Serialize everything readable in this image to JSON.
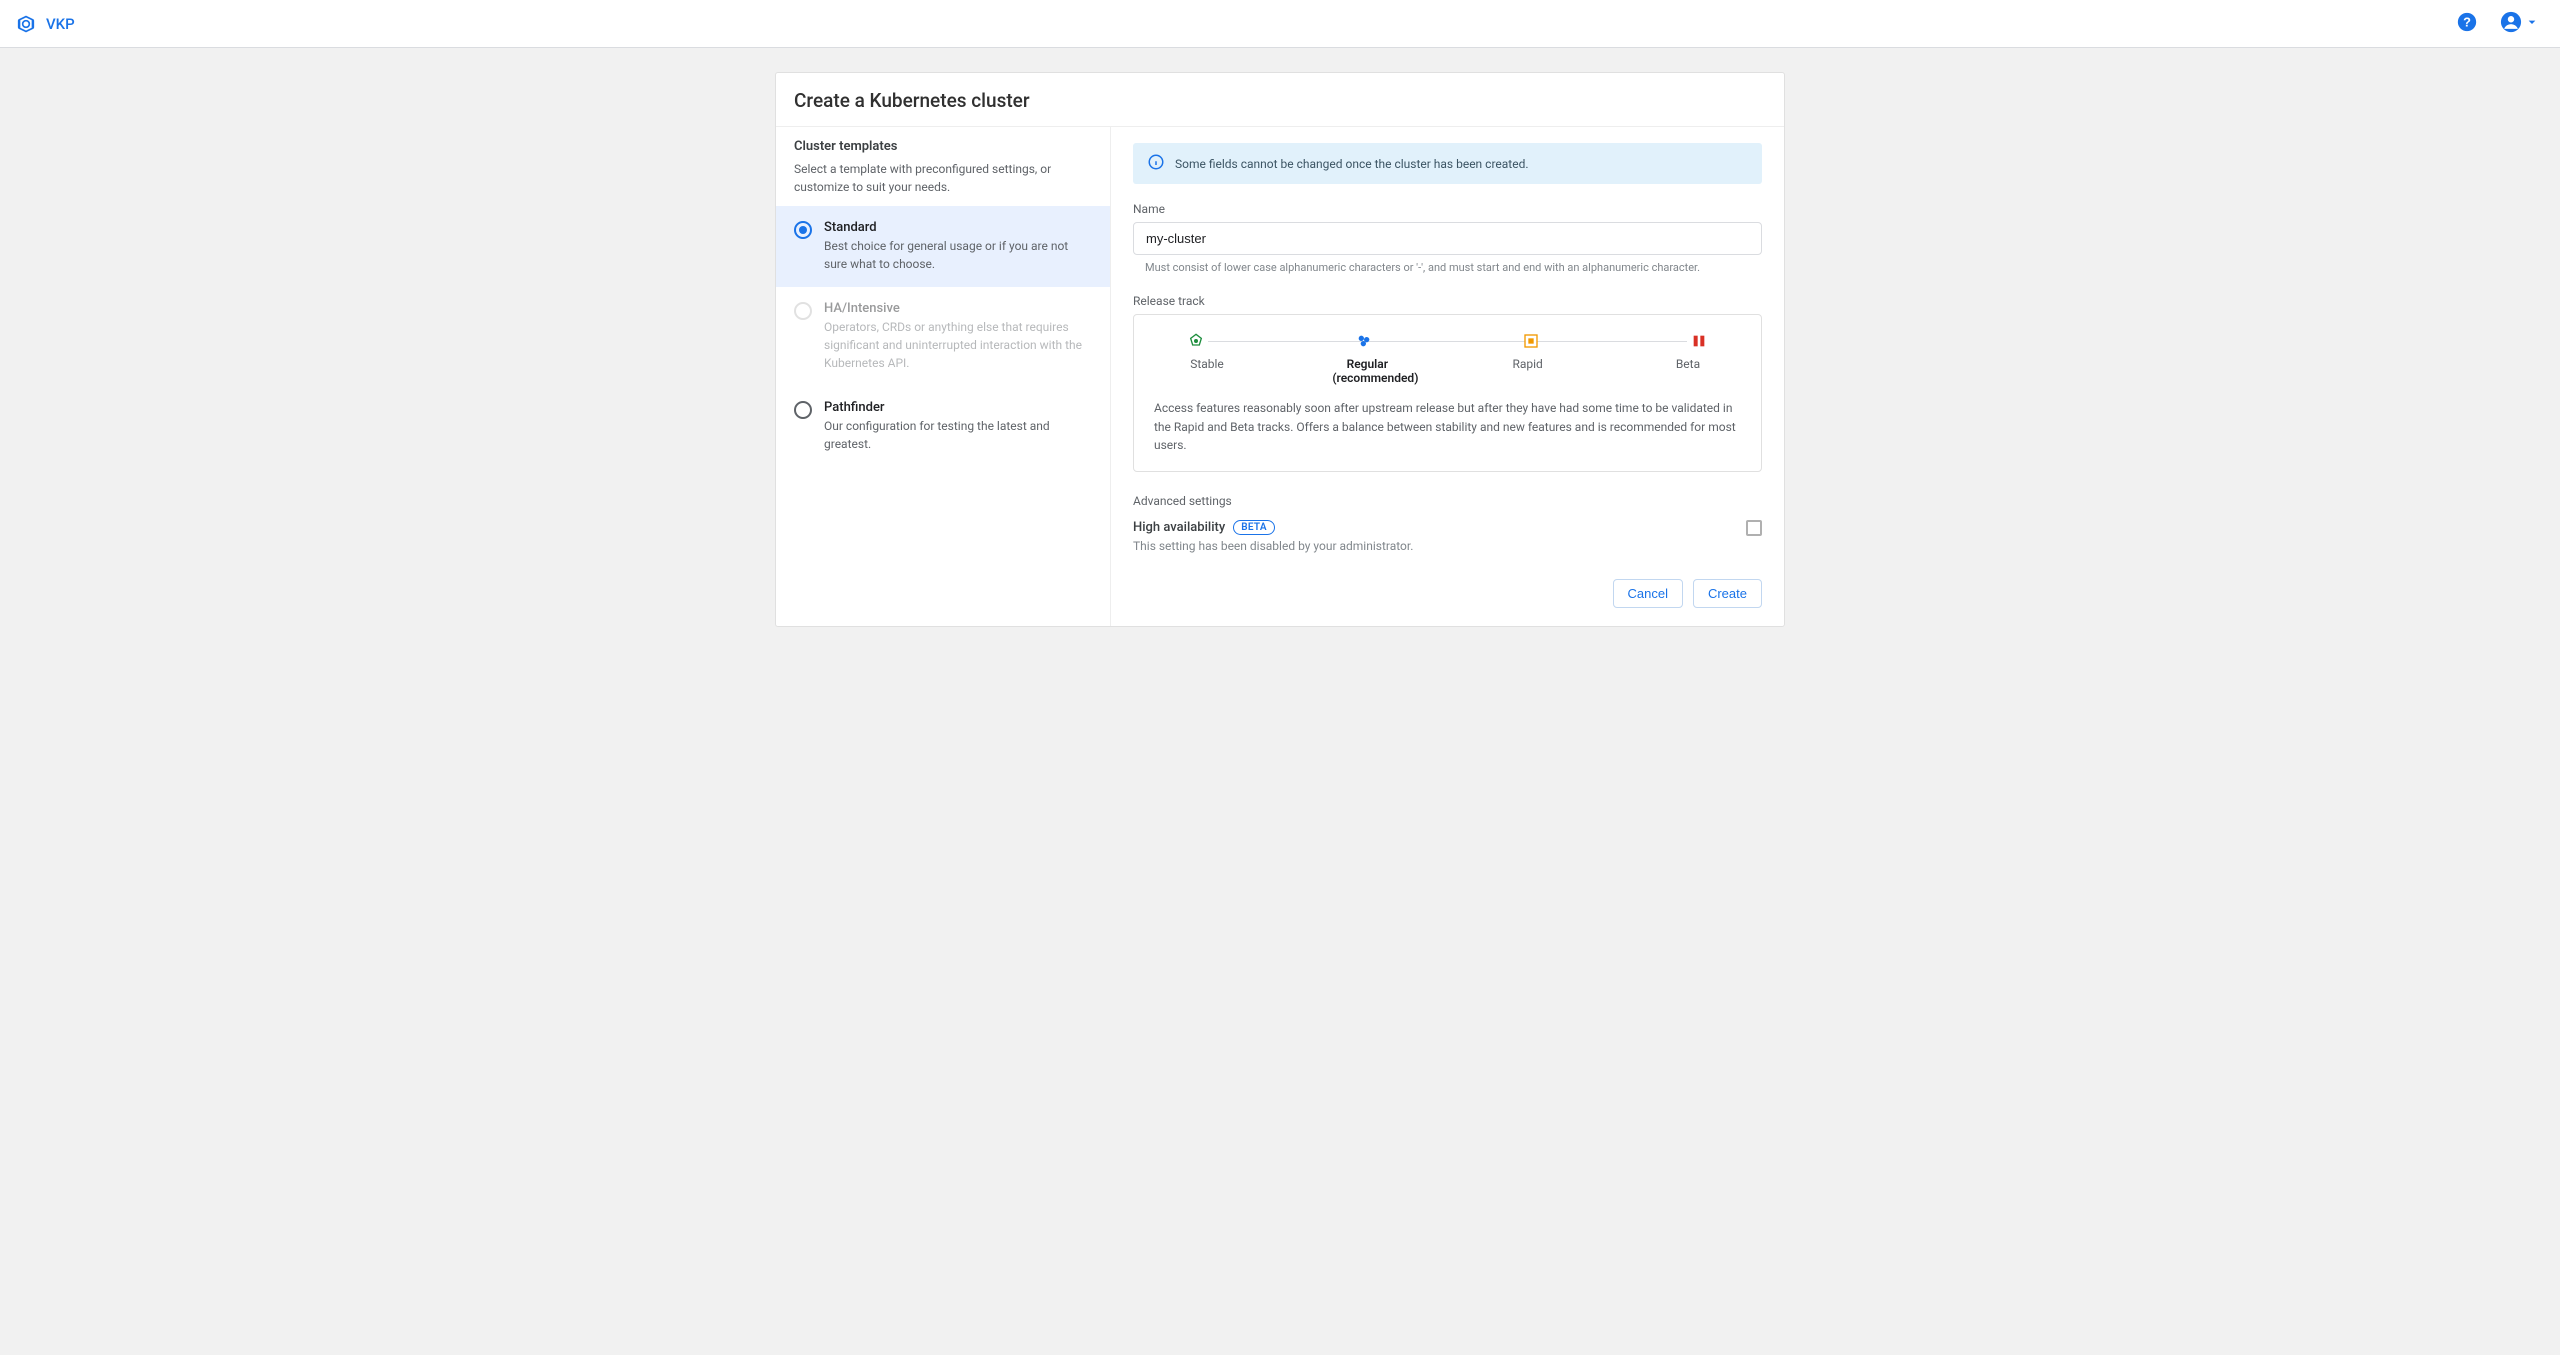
{
  "brand": "VKP",
  "page_title": "Create a Kubernetes cluster",
  "sidebar": {
    "title": "Cluster templates",
    "subtitle": "Select a template with preconfigured settings, or customize to suit your needs.",
    "templates": [
      {
        "name": "Standard",
        "desc": "Best choice for general usage or if you are not sure what to choose."
      },
      {
        "name": "HA/Intensive",
        "desc": "Operators, CRDs or anything else that requires significant and uninterrupted interaction with the Kubernetes API."
      },
      {
        "name": "Pathfinder",
        "desc": "Our configuration for testing the latest and greatest."
      }
    ]
  },
  "info_banner": "Some fields cannot be changed once the cluster has been created.",
  "name_field": {
    "label": "Name",
    "value": "my-cluster",
    "helper": "Must consist of lower case alphanumeric characters or '-', and must start and end with an alphanumeric character."
  },
  "release_track": {
    "label": "Release track",
    "options": [
      "Stable",
      "Regular (recommended)",
      "Rapid",
      "Beta"
    ],
    "selected_index": 1,
    "description": "Access features reasonably soon after upstream release but after they have had some time to be validated in the Rapid and Beta tracks. Offers a balance between stability and new features and is recommended for most users."
  },
  "advanced_label": "Advanced settings",
  "ha": {
    "title": "High availability",
    "chip": "BETA",
    "subtitle": "This setting has been disabled by your administrator.",
    "checked": false
  },
  "actions": {
    "cancel": "Cancel",
    "create": "Create"
  }
}
